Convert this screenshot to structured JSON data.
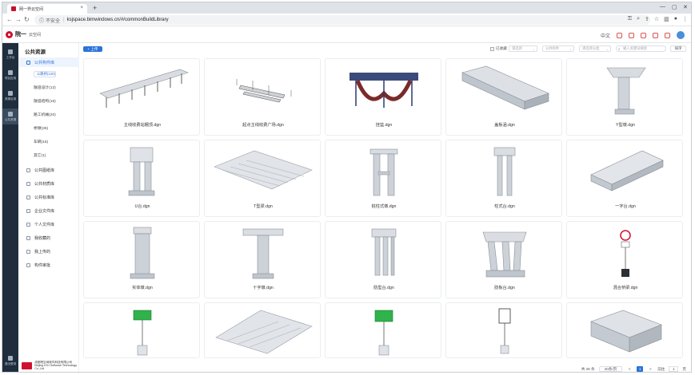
{
  "browser": {
    "tab_title": "网一界云空间",
    "url_security": "不安全",
    "url": "ksjspace.bimwindows.cn/#/commonBuildLibrary"
  },
  "app": {
    "brand": "院一",
    "brand_sub": "云空间",
    "lang": "中文"
  },
  "rail": [
    "工作台",
    "项目应用",
    "资源应用",
    "公共资源",
    "退出登录"
  ],
  "sidebar": {
    "title": "公共资源",
    "group": "公共构件库",
    "subs": [
      "公路桥(120)",
      "隧道设计(12)",
      "隧道结构(16)",
      "路工机械(20)",
      "桥墩(26)",
      "车辆(16)",
      "其它(1)"
    ],
    "items": [
      "公共图纸库",
      "公共材质库",
      "公共标准库",
      "企业文件库",
      "个人文件库",
      "我收藏的",
      "我上传的",
      "构件审批"
    ],
    "company": "成都院空间软件科技有限公司",
    "company_en": "Beijing KSJ Software Technology Co.,Ltd"
  },
  "toolbar": {
    "upload": "+ 上传",
    "favorited": "已收藏",
    "filter1": "请选择",
    "filter2": "公共构件",
    "filter3": "请选择分类",
    "search_placeholder": "输入关键词搜索",
    "sort": "排序"
  },
  "cards": [
    "主线收费站棚顶.dgn",
    "起点主线收费广场.dgn",
    "挂篮.dgn",
    "盖板涵.dgn",
    "Y型墩.dgn",
    "U台.dgn",
    "T型梁.dgn",
    "桩柱式墩.dgn",
    "柱式台.dgn",
    "一字台.dgn",
    "实体墩.dgn",
    "十字墩.dgn",
    "肋型台.dgn",
    "肋板台.dgn",
    "混合桥梁.dgn"
  ],
  "pager": {
    "total": "共 28 条",
    "size": "40条/页",
    "prev": "<",
    "page": "1",
    "next": ">",
    "goto": "前往",
    "goto_val": "1",
    "unit": "页"
  }
}
